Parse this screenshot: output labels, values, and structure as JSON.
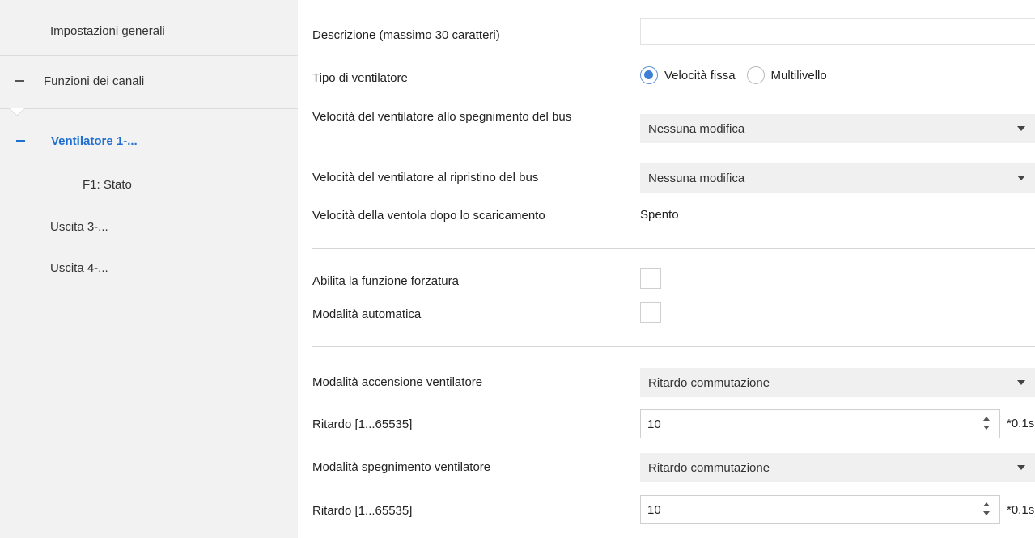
{
  "sidebar": {
    "items": [
      {
        "label": "Impostazioni generali"
      },
      {
        "label": "Funzioni dei canali"
      },
      {
        "label": "Ventilatore 1-..."
      },
      {
        "label": "F1: Stato"
      },
      {
        "label": "Uscita 3-..."
      },
      {
        "label": "Uscita 4-..."
      }
    ]
  },
  "form": {
    "description": {
      "label": "Descrizione (massimo 30 caratteri)",
      "value": ""
    },
    "fan_type": {
      "label": "Tipo di ventilatore",
      "options": [
        "Velocità fissa",
        "Multilivello"
      ],
      "selected": "Velocità fissa"
    },
    "speed_bus_off": {
      "label": "Velocità del ventilatore allo spegnimento del bus",
      "value": "Nessuna modifica"
    },
    "speed_bus_restore": {
      "label": "Velocità del ventilatore al ripristino del bus",
      "value": "Nessuna modifica"
    },
    "speed_after_download": {
      "label": "Velocità della ventola dopo lo scaricamento",
      "value": "Spento"
    },
    "forcing": {
      "label": "Abilita la funzione forzatura",
      "checked": false
    },
    "automatic": {
      "label": "Modalità automatica",
      "checked": false
    },
    "on_mode": {
      "label": "Modalità accensione ventilatore",
      "value": "Ritardo commutazione"
    },
    "on_delay": {
      "label": "Ritardo [1...65535]",
      "value": "10",
      "unit": "*0.1s"
    },
    "off_mode": {
      "label": "Modalità spegnimento ventilatore",
      "value": "Ritardo commutazione"
    },
    "off_delay": {
      "label": "Ritardo [1...65535]",
      "value": "10",
      "unit": "*0.1s"
    }
  },
  "colors": {
    "accent": "#1e6fd0",
    "sidebar_bg": "#f2f2f2",
    "select_bg": "#f0f0f0"
  }
}
